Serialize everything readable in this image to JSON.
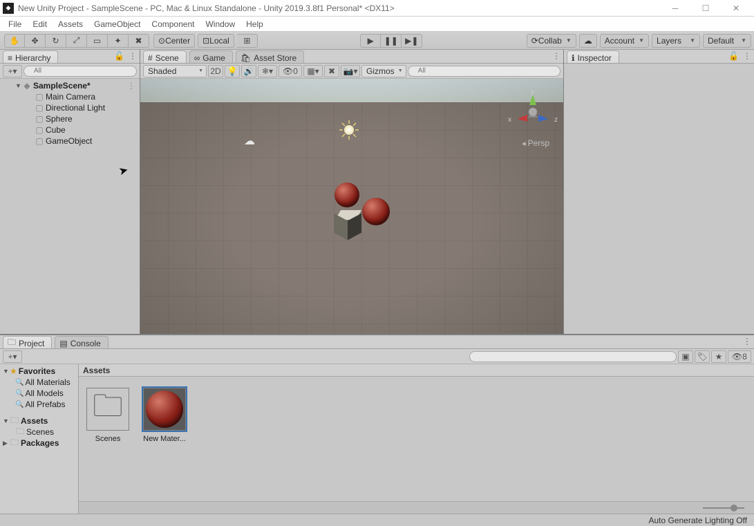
{
  "window": {
    "title": "New Unity Project - SampleScene - PC, Mac & Linux Standalone - Unity 2019.3.8f1 Personal* <DX11>"
  },
  "menu": [
    "File",
    "Edit",
    "Assets",
    "GameObject",
    "Component",
    "Window",
    "Help"
  ],
  "toolbar": {
    "center": "Center",
    "local": "Local",
    "collab": "Collab",
    "account": "Account",
    "layers": "Layers",
    "layout": "Default"
  },
  "hierarchy": {
    "tab": "Hierarchy",
    "search_placeholder": "All",
    "scene": "SampleScene*",
    "items": [
      "Main Camera",
      "Directional Light",
      "Sphere",
      "Cube",
      "GameObject"
    ]
  },
  "scene": {
    "tabs": [
      "Scene",
      "Game",
      "Asset Store"
    ],
    "shading": "Shaded",
    "twoD": "2D",
    "gizmos": "Gizmos",
    "light_count": "0",
    "search_placeholder": "All",
    "persp": "Persp",
    "axes": {
      "x": "x",
      "y": "y",
      "z": "z"
    }
  },
  "inspector": {
    "tab": "Inspector"
  },
  "project": {
    "tabs": [
      "Project",
      "Console"
    ],
    "hidden_count": "8",
    "favorites": "Favorites",
    "fav_items": [
      "All Materials",
      "All Models",
      "All Prefabs"
    ],
    "roots": [
      "Assets",
      "Packages"
    ],
    "assets_children": [
      "Scenes"
    ],
    "crumb": "Assets",
    "assets": [
      {
        "name": "Scenes",
        "type": "folder"
      },
      {
        "name": "New Mater...",
        "type": "material"
      }
    ]
  },
  "status": {
    "lighting": "Auto Generate Lighting Off"
  }
}
